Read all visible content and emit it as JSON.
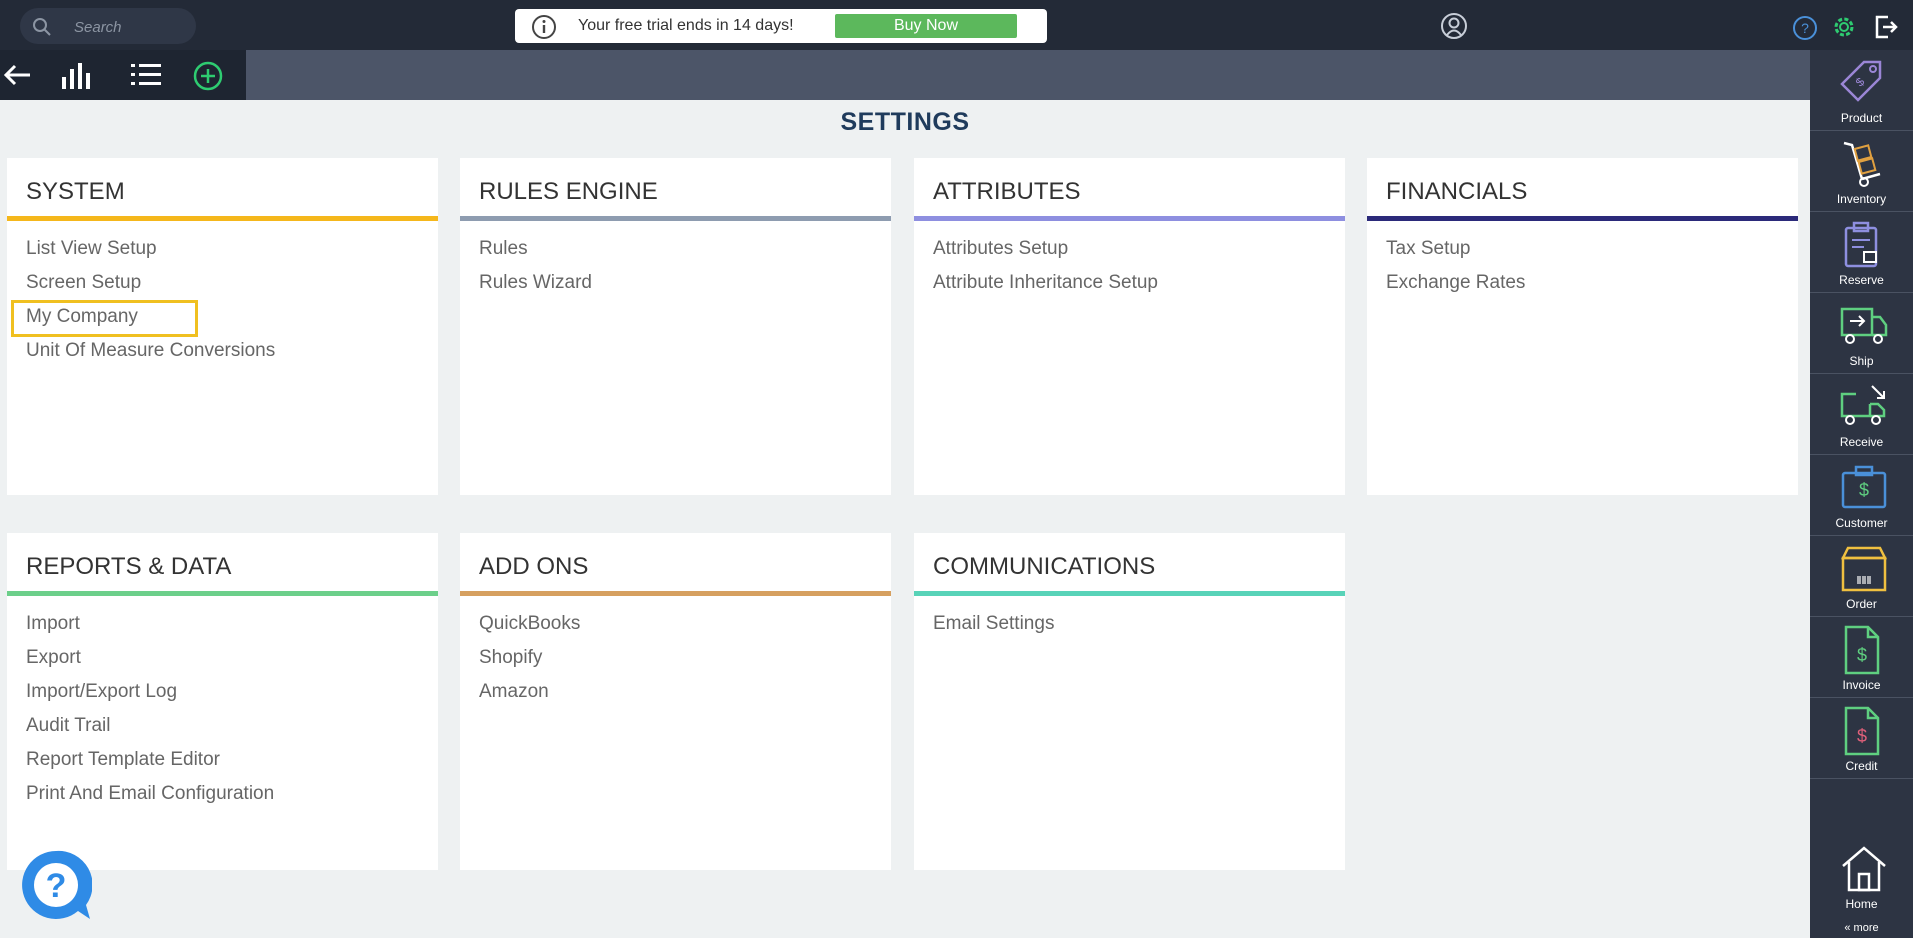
{
  "search": {
    "placeholder": "Search"
  },
  "trial": {
    "message": "Your free trial ends in 14 days!",
    "buy_label": "Buy Now"
  },
  "page_title": "SETTINGS",
  "colors": {
    "accent_gear": "#2ecc71",
    "buy": "#5cb85c"
  },
  "cards": [
    {
      "title": "SYSTEM",
      "color": "#f5b71b",
      "items": [
        "List View Setup",
        "Screen Setup",
        "My Company",
        "Unit Of Measure Conversions"
      ]
    },
    {
      "title": "RULES ENGINE",
      "color": "#8e9cb0",
      "items": [
        "Rules",
        "Rules Wizard"
      ]
    },
    {
      "title": "ATTRIBUTES",
      "color": "#8e8fe0",
      "items": [
        "Attributes Setup",
        "Attribute Inheritance Setup"
      ]
    },
    {
      "title": "FINANCIALS",
      "color": "#2b2a7a",
      "items": [
        "Tax Setup",
        "Exchange Rates"
      ]
    },
    {
      "title": "REPORTS & DATA",
      "color": "#6ccf8a",
      "items": [
        "Import",
        "Export",
        "Import/Export Log",
        "Audit Trail",
        "Report Template Editor",
        "Print And Email Configuration"
      ]
    },
    {
      "title": "ADD ONS",
      "color": "#d6a060",
      "items": [
        "QuickBooks",
        "Shopify",
        "Amazon"
      ]
    },
    {
      "title": "COMMUNICATIONS",
      "color": "#58d3b8",
      "items": [
        "Email Settings"
      ]
    }
  ],
  "rightbar": {
    "items": [
      "Product",
      "Inventory",
      "Reserve",
      "Ship",
      "Receive",
      "Customer",
      "Order",
      "Invoice",
      "Credit"
    ],
    "home": "Home",
    "more": "« more"
  }
}
